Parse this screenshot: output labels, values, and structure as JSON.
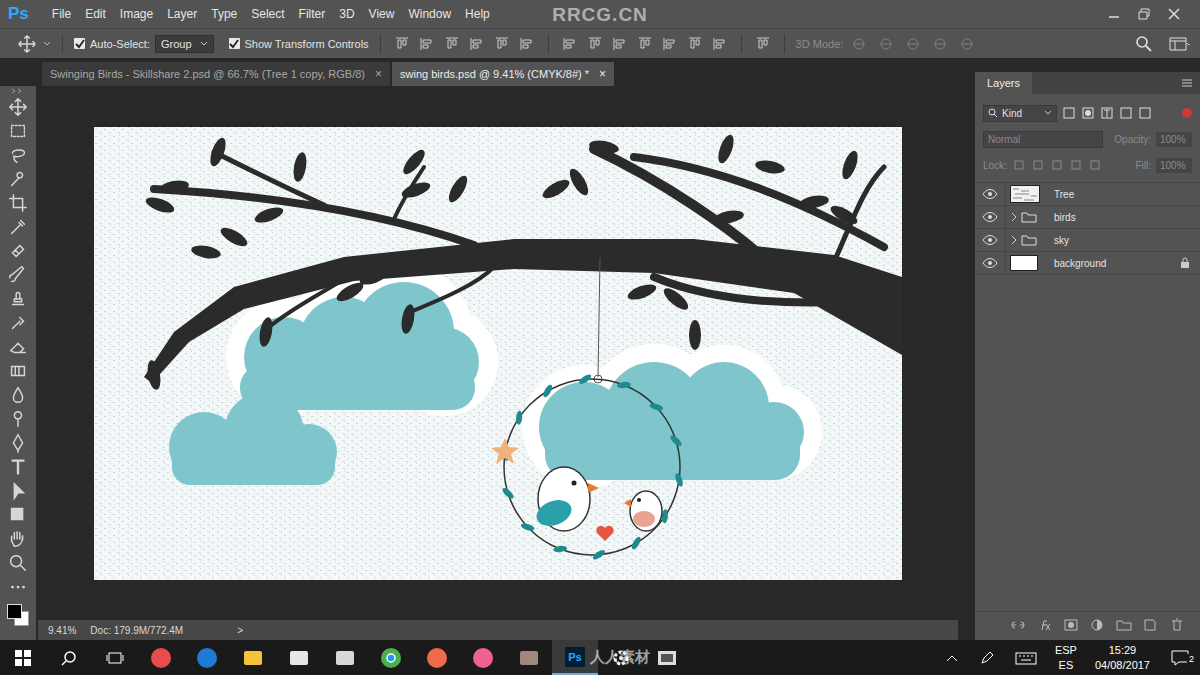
{
  "app": {
    "logo": "Ps",
    "watermark": "RRCG.CN"
  },
  "menu": [
    "File",
    "Edit",
    "Image",
    "Layer",
    "Type",
    "Select",
    "Filter",
    "3D",
    "View",
    "Window",
    "Help"
  ],
  "options_bar": {
    "auto_select": {
      "label": "Auto-Select:",
      "checked": true
    },
    "auto_select_target": "Group",
    "transform_controls": {
      "label": "Show Transform Controls",
      "checked": true
    },
    "mode_3d": {
      "label": "3D Mode:",
      "disabled": true
    }
  },
  "tabs": [
    {
      "label": "Swinging Birds - Skillshare 2.psd @ 66.7% (Tree 1 copy, RGB/8)",
      "selected": false,
      "close": "×"
    },
    {
      "label": "swing birds.psd @ 9.41% (CMYK/8#) *",
      "selected": true,
      "close": "×"
    }
  ],
  "status_bar": {
    "zoom": "9.41%",
    "doc": "Doc: 179.9M/772.4M",
    "arrow": ">"
  },
  "layers_panel": {
    "title": "Layers",
    "filter": "Kind",
    "blend_mode": "Normal",
    "opacity_label": "Opacity:",
    "opacity": "100%",
    "lock_label": "Lock:",
    "fill_label": "Fill:",
    "fill": "100%",
    "options_disabled": true,
    "layers": [
      {
        "name": "Tree",
        "kind": "pixel",
        "visible": true,
        "locked": false
      },
      {
        "name": "birds",
        "kind": "group",
        "visible": true,
        "locked": false,
        "expanded": false
      },
      {
        "name": "sky",
        "kind": "group",
        "visible": true,
        "locked": false,
        "expanded": false
      },
      {
        "name": "background",
        "kind": "fill",
        "visible": true,
        "locked": true
      }
    ]
  },
  "taskbar": {
    "watermark": "人人素材",
    "language": "ESP",
    "region": "ES",
    "time": "15:29",
    "date": "04/08/2017",
    "notifications": "2"
  }
}
